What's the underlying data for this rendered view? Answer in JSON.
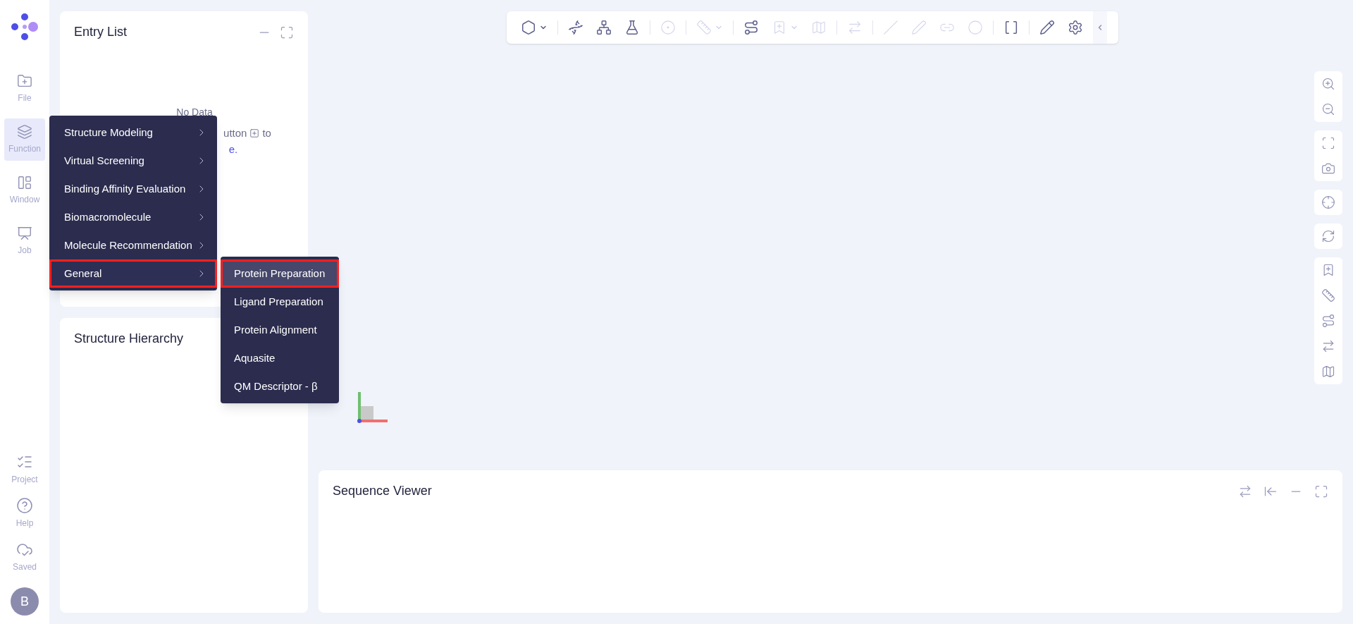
{
  "sidebar": {
    "top_items": [
      {
        "label": "File",
        "selected": false
      },
      {
        "label": "Function",
        "selected": true
      },
      {
        "label": "Window",
        "selected": false
      },
      {
        "label": "Job",
        "selected": false
      }
    ],
    "bottom_items": [
      {
        "label": "Project"
      },
      {
        "label": "Help"
      },
      {
        "label": "Saved"
      }
    ],
    "avatar": "B"
  },
  "entry_list": {
    "title": "Entry List",
    "empty_title": "No Data",
    "hint_fragment": "utton",
    "hint_after_icon": "to",
    "link_fragment": "e."
  },
  "structure_hierarchy": {
    "title": "Structure Hierarchy"
  },
  "toolbar": [
    {
      "disabled": false,
      "dropdown": true
    },
    {
      "disabled": false,
      "dropdown": false
    },
    {
      "disabled": false,
      "dropdown": false
    },
    {
      "disabled": false,
      "dropdown": false
    },
    {
      "disabled": true,
      "dropdown": false
    },
    {
      "disabled": true,
      "dropdown": true
    },
    {
      "disabled": false,
      "dropdown": false
    },
    {
      "disabled": true,
      "dropdown": true
    },
    {
      "disabled": true,
      "dropdown": false
    },
    {
      "disabled": true,
      "dropdown": false
    },
    {
      "disabled": true,
      "dropdown": false
    },
    {
      "disabled": true,
      "dropdown": false
    },
    {
      "disabled": true,
      "dropdown": false
    },
    {
      "disabled": true,
      "dropdown": false
    },
    {
      "disabled": false,
      "dropdown": false
    },
    {
      "disabled": false,
      "dropdown": false
    },
    {
      "disabled": false,
      "dropdown": false
    }
  ],
  "function_menu": [
    {
      "label": "Structure Modeling",
      "selected": false
    },
    {
      "label": "Virtual Screening",
      "selected": false
    },
    {
      "label": "Binding Affinity Evaluation",
      "selected": false
    },
    {
      "label": "Biomacromolecule",
      "selected": false
    },
    {
      "label": "Molecule Recommendation",
      "selected": false
    },
    {
      "label": "General",
      "selected": true
    }
  ],
  "general_submenu": [
    {
      "label": "Protein Preparation",
      "selected": true
    },
    {
      "label": "Ligand Preparation",
      "selected": false
    },
    {
      "label": "Protein Alignment",
      "selected": false
    },
    {
      "label": "Aquasite",
      "selected": false
    },
    {
      "label": "QM Descriptor - β",
      "selected": false
    }
  ],
  "sequence_viewer": {
    "title": "Sequence Viewer"
  }
}
